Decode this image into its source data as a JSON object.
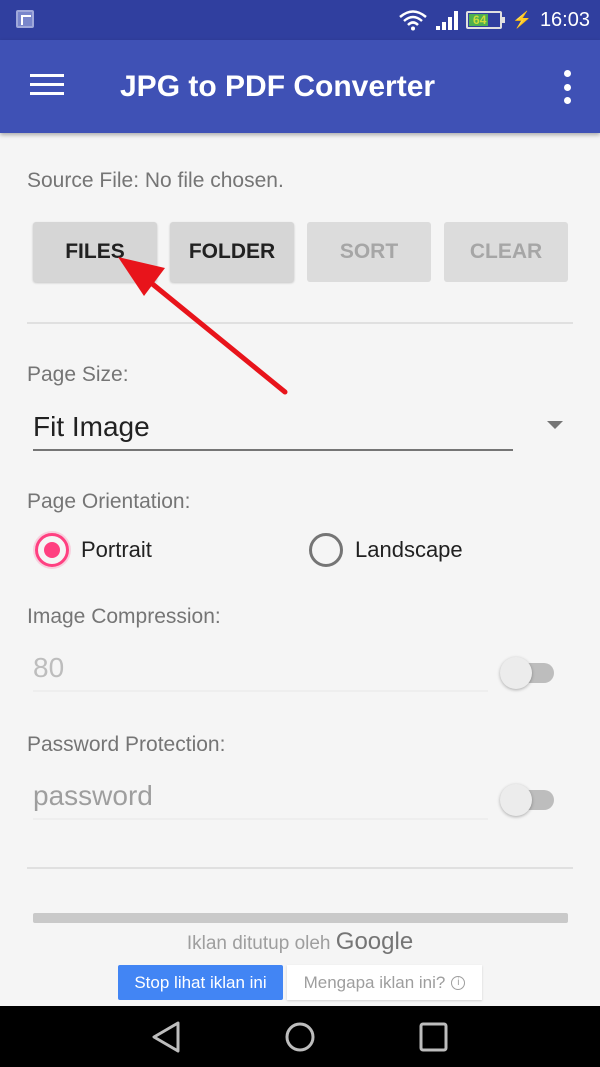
{
  "status_bar": {
    "notification_icon": "image-notification-icon",
    "battery_percent": "64",
    "battery_level": 0.64,
    "charging": true,
    "time": "16:03"
  },
  "app_bar": {
    "title": "JPG to PDF Converter",
    "menu_icon": "hamburger-menu-icon",
    "overflow_icon": "more-vert-icon"
  },
  "source": {
    "label": "Source File: No file chosen."
  },
  "buttons": [
    {
      "label": "FILES",
      "enabled": true
    },
    {
      "label": "FOLDER",
      "enabled": true
    },
    {
      "label": "SORT",
      "enabled": false
    },
    {
      "label": "CLEAR",
      "enabled": false
    }
  ],
  "page_size": {
    "label": "Page Size:",
    "selected": "Fit Image"
  },
  "orientation": {
    "label": "Page Orientation:",
    "options": [
      {
        "label": "Portrait",
        "checked": true
      },
      {
        "label": "Landscape",
        "checked": false
      }
    ]
  },
  "compression": {
    "label": "Image Compression:",
    "placeholder": "80",
    "enabled": false
  },
  "password": {
    "label": "Password Protection:",
    "placeholder": "password",
    "enabled": false
  },
  "ad": {
    "closed_text": "Iklan ditutup oleh",
    "brand": "Google",
    "stop_button": "Stop lihat iklan ini",
    "why_button": "Mengapa iklan ini?",
    "info_glyph": "i"
  },
  "annotation": {
    "type": "arrow",
    "color": "#e8141b",
    "target": "files-button"
  },
  "colors": {
    "primary": "#3f51b5",
    "primary_dark": "#303f9f",
    "accent": "#ff4081",
    "ad_blue": "#4285f4"
  }
}
